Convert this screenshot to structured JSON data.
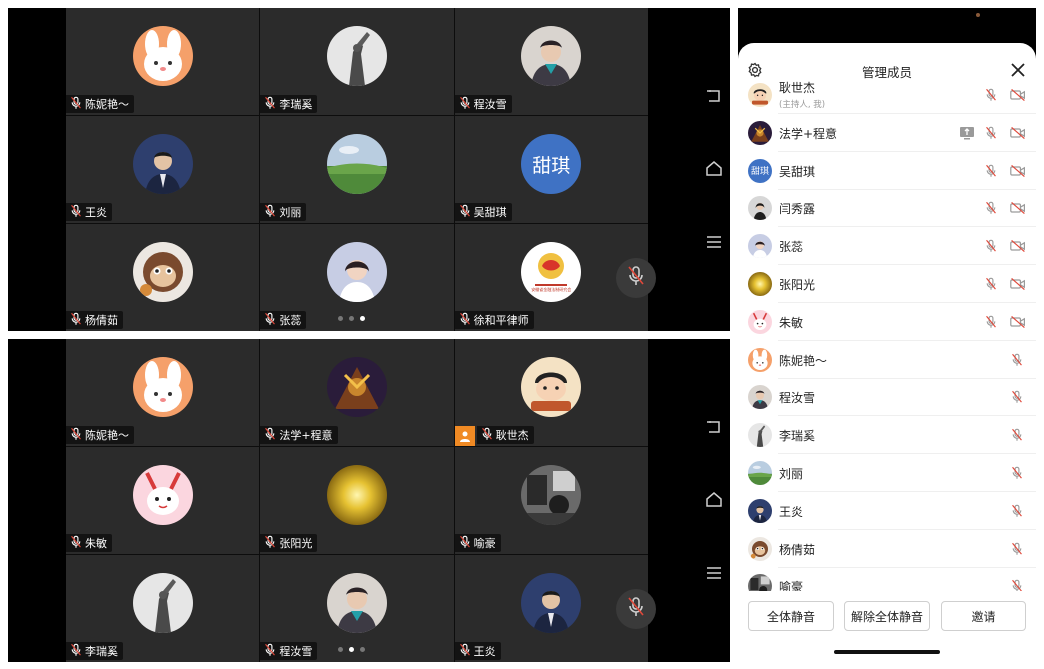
{
  "colors": {
    "host_badge": "#f08a24",
    "avatar_blue": "#3f72c4",
    "tile_bg": "#2b2b2b"
  },
  "top_screen": {
    "tiles": [
      {
        "name": "陈妮艳～",
        "avatar": "bunny-cartoon"
      },
      {
        "name": "李瑞奚",
        "avatar": "statue-photo"
      },
      {
        "name": "程汝雪",
        "avatar": "girl-scarf-photo"
      },
      {
        "name": "王炎",
        "avatar": "man-suit-photo"
      },
      {
        "name": "刘丽",
        "avatar": "green-field-photo"
      },
      {
        "name": "吴甜琪",
        "avatar_text": "甜琪"
      },
      {
        "name": "杨倩茹",
        "avatar": "monkey-cartoon"
      },
      {
        "name": "张蕊",
        "avatar": "girl-portrait-photo"
      },
      {
        "name": "徐和平律师",
        "avatar": "logo-emblem",
        "logo_text": "安徽省金融法制研究会"
      }
    ],
    "page_dots": 3,
    "active_dot": 2
  },
  "bottom_screen": {
    "tiles": [
      {
        "name": "陈妮艳～",
        "avatar": "bunny-cartoon"
      },
      {
        "name": "法学+程意",
        "avatar": "game-hero"
      },
      {
        "name": "耿世杰",
        "avatar": "boy-cartoon",
        "host": true
      },
      {
        "name": "朱敏",
        "avatar": "pink-cartoon"
      },
      {
        "name": "张阳光",
        "avatar": "sun-photo"
      },
      {
        "name": "喻豪",
        "avatar": "bw-photo"
      },
      {
        "name": "李瑞奚",
        "avatar": "statue-photo"
      },
      {
        "name": "程汝雪",
        "avatar": "girl-scarf-photo"
      },
      {
        "name": "王炎",
        "avatar": "man-suit-photo"
      }
    ],
    "page_dots": 3,
    "active_dot": 1
  },
  "panel": {
    "title": "管理成员",
    "members": [
      {
        "name": "耿世杰",
        "sub": "(主持人, 我)",
        "avatar": "boy-cartoon",
        "video": true,
        "share": false
      },
      {
        "name": "法学+程意",
        "avatar": "game-hero",
        "video": true,
        "share": true
      },
      {
        "name": "吴甜琪",
        "avatar_text": "甜琪",
        "video": true,
        "share": false
      },
      {
        "name": "闫秀露",
        "avatar": "woman-photo",
        "video": true,
        "share": false
      },
      {
        "name": "张蕊",
        "avatar": "girl-portrait-photo",
        "video": true,
        "share": false
      },
      {
        "name": "张阳光",
        "avatar": "sun-photo",
        "video": true,
        "share": false
      },
      {
        "name": "朱敏",
        "avatar": "pink-cartoon",
        "video": true,
        "share": false
      },
      {
        "name": "陈妮艳～",
        "avatar": "bunny-cartoon",
        "video": false,
        "share": false
      },
      {
        "name": "程汝雪",
        "avatar": "girl-scarf-photo",
        "video": false,
        "share": false
      },
      {
        "name": "李瑞奚",
        "avatar": "statue-photo",
        "video": false,
        "share": false
      },
      {
        "name": "刘丽",
        "avatar": "green-field-photo",
        "video": false,
        "share": false
      },
      {
        "name": "王炎",
        "avatar": "man-suit-photo",
        "video": false,
        "share": false
      },
      {
        "name": "杨倩茹",
        "avatar": "monkey-cartoon",
        "video": false,
        "share": false
      },
      {
        "name": "喻豪",
        "avatar": "bw-photo",
        "video": false,
        "share": false
      }
    ],
    "buttons": {
      "mute_all": "全体静音",
      "unmute_all": "解除全体静音",
      "invite": "邀请"
    }
  }
}
